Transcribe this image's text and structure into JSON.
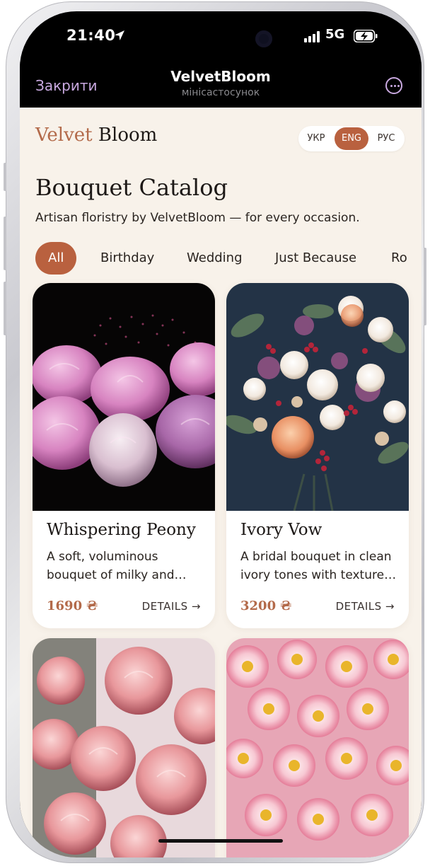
{
  "status_bar": {
    "time": "21:40",
    "network": "5G"
  },
  "mini_app": {
    "close_label": "Закрити",
    "title": "VelvetBloom",
    "subtitle": "мініcастосунок"
  },
  "brand": {
    "part1": "Velvet",
    "part2": "Bloom"
  },
  "languages": [
    {
      "label": "УКР",
      "active": false
    },
    {
      "label": "ENG",
      "active": true
    },
    {
      "label": "РУС",
      "active": false
    }
  ],
  "page": {
    "title": "Bouquet Catalog",
    "subtitle": "Artisan floristry by VelvetBloom — for every occasion."
  },
  "categories": [
    {
      "label": "All",
      "active": true
    },
    {
      "label": "Birthday",
      "active": false
    },
    {
      "label": "Wedding",
      "active": false
    },
    {
      "label": "Just Because",
      "active": false
    },
    {
      "label": "Ro",
      "active": false
    }
  ],
  "products": [
    {
      "title": "Whispering Peony",
      "desc": "A soft, voluminous bouquet of milky and…",
      "price": "1690 ₴",
      "details": "DETAILS →"
    },
    {
      "title": "Ivory Vow",
      "desc": "A bridal bouquet in clean ivory tones with texture…",
      "price": "3200 ₴",
      "details": "DETAILS →"
    },
    {
      "title": "",
      "desc": "",
      "price": "",
      "details": ""
    },
    {
      "title": "",
      "desc": "",
      "price": "",
      "details": ""
    }
  ],
  "colors": {
    "accent": "#b9613f",
    "price": "#b36a4a",
    "background": "#f8f2ea",
    "mini_accent": "#c9a9e0"
  }
}
